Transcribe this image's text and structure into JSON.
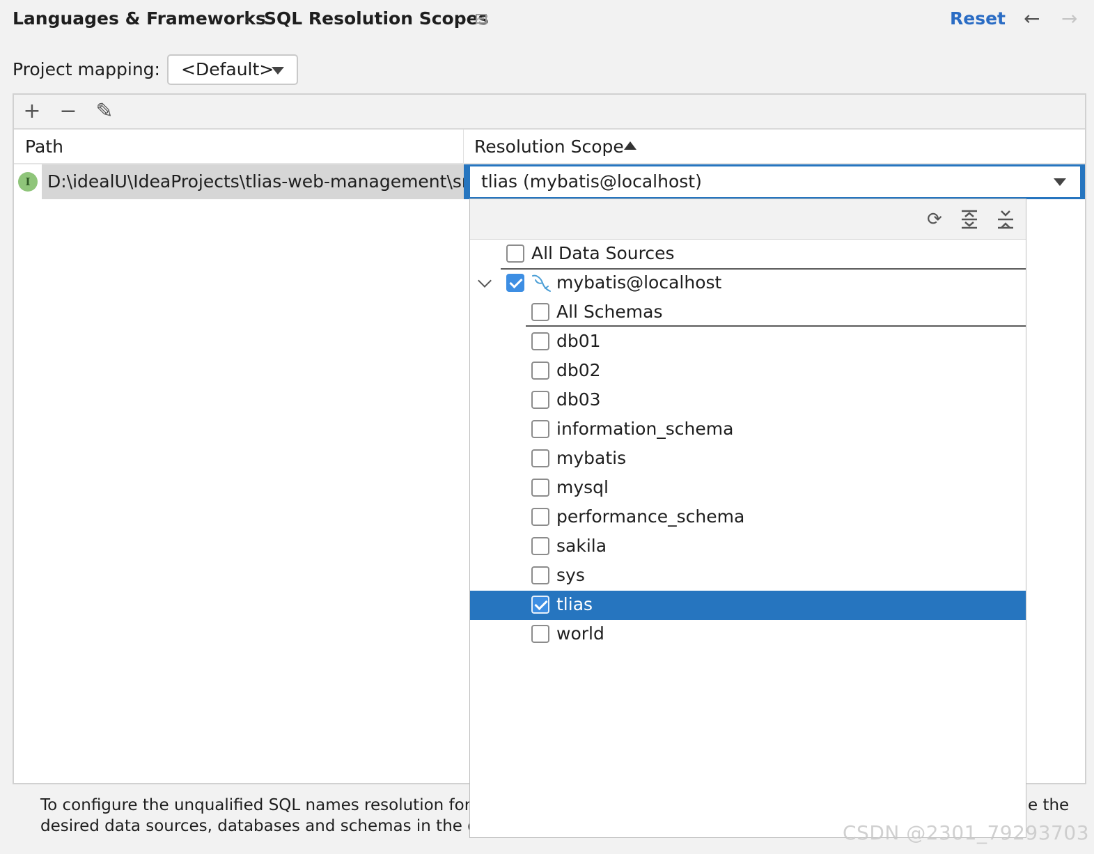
{
  "header": {
    "breadcrumb": [
      "Languages & Frameworks",
      "SQL Resolution Scopes"
    ],
    "reset_label": "Reset",
    "back_icon": "←",
    "forward_icon": "→"
  },
  "project_mapping": {
    "label": "Project mapping:",
    "value": "<Default>"
  },
  "toolbar": {
    "add": "+",
    "remove": "−",
    "edit": "✎"
  },
  "table": {
    "columns": [
      "Path",
      "Resolution Scope"
    ],
    "rows": [
      {
        "path": "D:\\idealU\\IdeaProjects\\tlias-web-management\\src\\main\\resources",
        "scope": "tlias (mybatis@localhost)"
      }
    ]
  },
  "popup": {
    "all_data_sources": "All Data Sources",
    "data_source": "mybatis@localhost",
    "all_schemas": "All Schemas",
    "schemas": [
      {
        "name": "db01",
        "checked": false
      },
      {
        "name": "db02",
        "checked": false
      },
      {
        "name": "db03",
        "checked": false
      },
      {
        "name": "information_schema",
        "checked": false
      },
      {
        "name": "mybatis",
        "checked": false
      },
      {
        "name": "mysql",
        "checked": false
      },
      {
        "name": "performance_schema",
        "checked": false
      },
      {
        "name": "sakila",
        "checked": false
      },
      {
        "name": "sys",
        "checked": false
      },
      {
        "name": "tlias",
        "checked": true
      },
      {
        "name": "world",
        "checked": false
      }
    ],
    "icons": [
      "refresh-icon",
      "expand-all-icon",
      "collapse-all-icon"
    ]
  },
  "hint": {
    "line1": "To configure the unqualified SQL names resolution for a fi",
    "line2": "desired data sources, databases and schemas in the drop c",
    "tail": "e the"
  },
  "watermark": "CSDN @2301_79293703",
  "colors": {
    "accent": "#2675bf",
    "link": "#2a6cc4",
    "checkbox": "#3d8ee3"
  }
}
